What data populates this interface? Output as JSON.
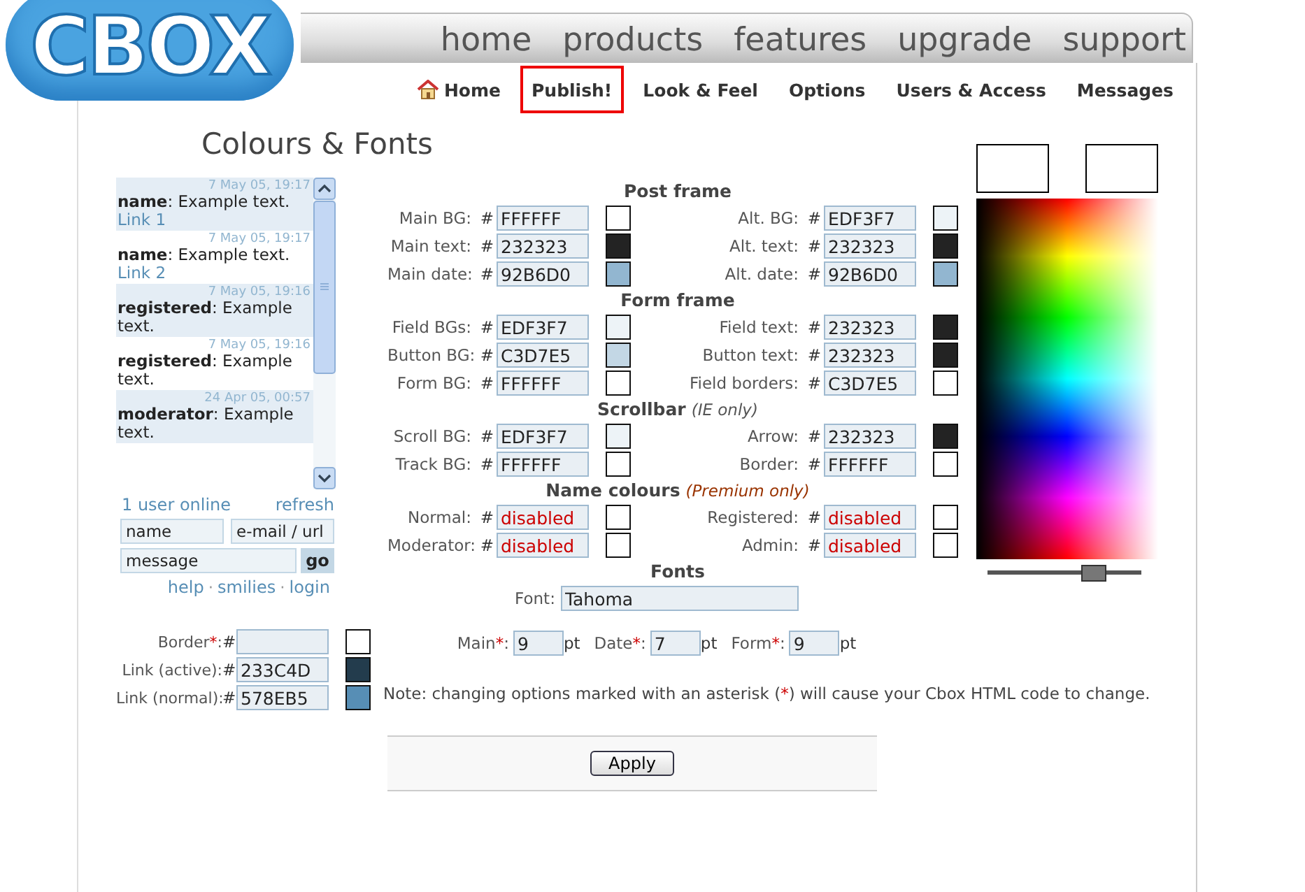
{
  "logo": "CBOX",
  "top_nav": [
    "home",
    "products",
    "features",
    "upgrade",
    "support"
  ],
  "hash": "#",
  "sub_nav": [
    {
      "label": "Home",
      "kind": "home",
      "selected": false
    },
    {
      "label": "Publish!",
      "kind": "plain",
      "selected": true
    },
    {
      "label": "Look & Feel",
      "kind": "plain",
      "selected": false
    },
    {
      "label": "Options",
      "kind": "plain",
      "selected": false
    },
    {
      "label": "Users & Access",
      "kind": "plain",
      "selected": false
    },
    {
      "label": "Messages",
      "kind": "plain",
      "selected": false
    }
  ],
  "title": "Colours & Fonts",
  "preview": {
    "messages": [
      {
        "date": "7 May 05, 19:17",
        "name": "name",
        "text": ": Example text.",
        "link": "Link 1",
        "alt": true
      },
      {
        "date": "7 May 05, 19:17",
        "name": "name",
        "text": ": Example text.",
        "link": "Link 2",
        "alt": false
      },
      {
        "date": "7 May 05, 19:16",
        "name": "registered",
        "text": ": Example text.",
        "alt": true
      },
      {
        "date": "7 May 05, 19:16",
        "name": "registered",
        "text": ": Example text.",
        "alt": false
      },
      {
        "date": "24 Apr 05, 00:57",
        "name": "moderator",
        "text": ": Example text.",
        "alt": true
      }
    ],
    "online": "1 user online",
    "refresh": "refresh",
    "name_placeholder": "name",
    "email_placeholder": "e-mail / url",
    "message_placeholder": "message",
    "go": "go",
    "links": [
      "help",
      "smilies",
      "login"
    ],
    "separator": "·"
  },
  "left_colours": [
    {
      "label": "Border",
      "asterisk": "*",
      "suffix": ":",
      "color": "#ffffff"
    },
    {
      "label": "Link (active):",
      "value": "233C4D",
      "color": "#233c4d"
    },
    {
      "label": "Link (normal):",
      "value": "578EB5",
      "color": "#578eb5"
    }
  ],
  "sections": [
    {
      "heading": "Post frame",
      "rows": [
        [
          {
            "label": "Main BG:",
            "value": "FFFFFF",
            "color": "#ffffff"
          },
          {
            "label": "Alt. BG:",
            "value": "EDF3F7",
            "color": "#edf3f7"
          }
        ],
        [
          {
            "label": "Main text:",
            "value": "232323",
            "color": "#232323"
          },
          {
            "label": "Alt. text:",
            "value": "232323",
            "color": "#232323"
          }
        ],
        [
          {
            "label": "Main date:",
            "value": "92B6D0",
            "color": "#92b6d0"
          },
          {
            "label": "Alt. date:",
            "value": "92B6D0",
            "color": "#92b6d0"
          }
        ]
      ]
    },
    {
      "heading": "Form frame",
      "rows": [
        [
          {
            "label": "Field BGs:",
            "value": "EDF3F7",
            "color": "#edf3f7"
          },
          {
            "label": "Field text:",
            "value": "232323",
            "color": "#232323"
          }
        ],
        [
          {
            "label": "Button BG:",
            "value": "C3D7E5",
            "color": "#c3d7e5"
          },
          {
            "label": "Button text:",
            "value": "232323",
            "color": "#232323"
          }
        ],
        [
          {
            "label": "Form BG:",
            "value": "FFFFFF",
            "color": "#ffffff"
          },
          {
            "label": "Field borders:",
            "value": "C3D7E5",
            "color": "#ffffff"
          }
        ]
      ]
    },
    {
      "heading": "Scrollbar",
      "note": "(IE only)",
      "kind": "plain",
      "rows": [
        [
          {
            "label": "Scroll BG:",
            "value": "EDF3F7",
            "color": "#edf3f7"
          },
          {
            "label": "Arrow:",
            "value": "232323",
            "color": "#232323"
          }
        ],
        [
          {
            "label": "Track BG:",
            "value": "FFFFFF",
            "color": "#ffffff"
          },
          {
            "label": "Border:",
            "value": "FFFFFF",
            "color": "#ffffff"
          }
        ]
      ]
    },
    {
      "heading": "Name colours",
      "note": "(Premium only)",
      "kind": "premium",
      "rows": [
        [
          {
            "label": "Normal:",
            "value": "disabled",
            "color": "#ffffff",
            "disabled": true
          },
          {
            "label": "Registered:",
            "value": "disabled",
            "color": "#ffffff",
            "disabled": true
          }
        ],
        [
          {
            "label": "Moderator:",
            "value": "disabled",
            "color": "#ffffff",
            "disabled": true
          },
          {
            "label": "Admin:",
            "value": "disabled",
            "color": "#ffffff",
            "disabled": true
          }
        ]
      ]
    }
  ],
  "fonts": {
    "heading": "Fonts",
    "font_label": "Font:",
    "font": "Tahoma",
    "sizes": [
      {
        "label": "Main",
        "asterisk": "*",
        "suffix": ":",
        "value": "9",
        "unit": "pt"
      },
      {
        "label": "Date",
        "asterisk": "*",
        "suffix": ":",
        "value": "7",
        "unit": "pt"
      },
      {
        "label": "Form",
        "asterisk": "*",
        "suffix": ":",
        "value": "9",
        "unit": "pt"
      }
    ]
  },
  "note": {
    "before": "Note: changing options marked with an asterisk (",
    "mark": "*",
    "after": ") will cause your Cbox HTML code to change."
  },
  "picker": {
    "level": 0.69
  },
  "apply": "Apply"
}
